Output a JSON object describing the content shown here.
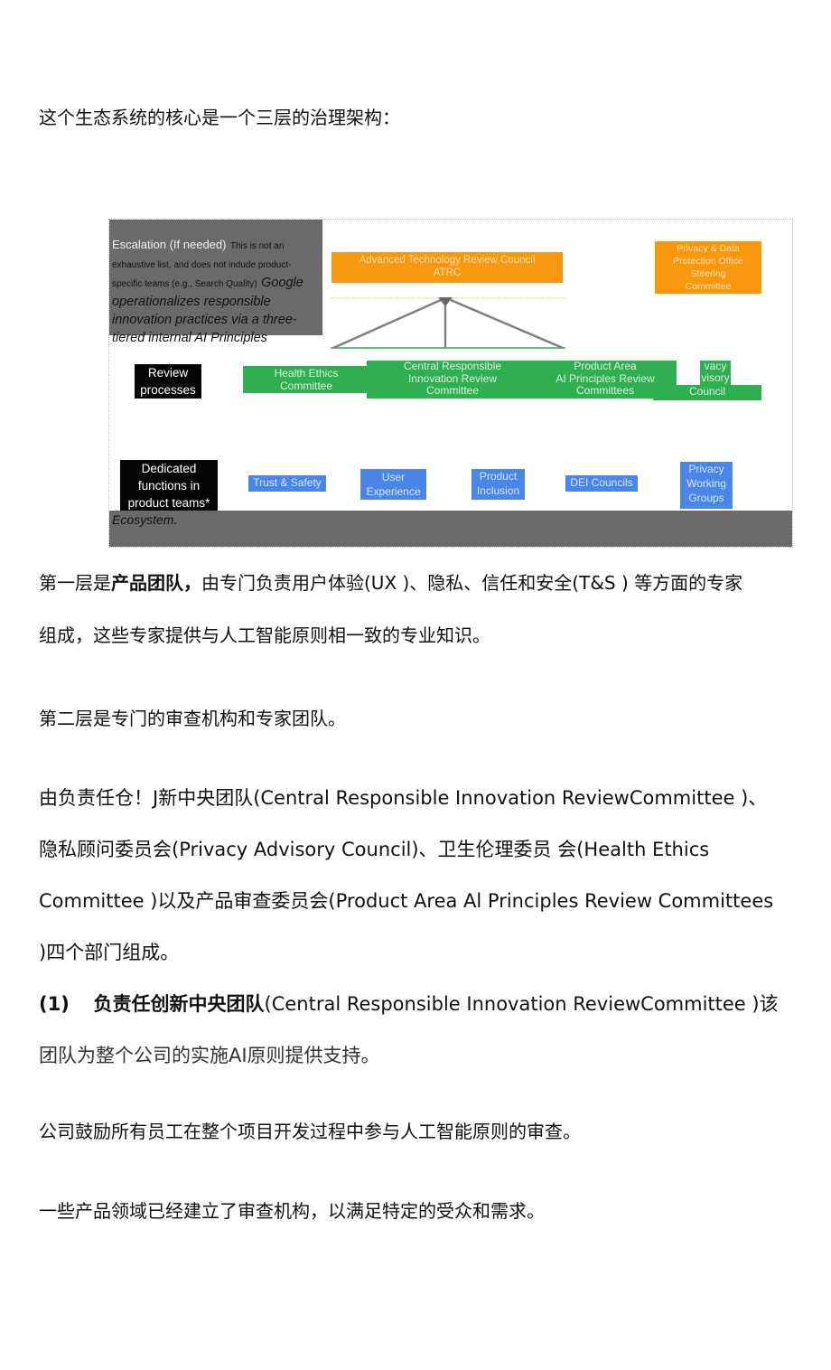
{
  "intro": "这个生态系统的核心是一个三层的治理架构：",
  "diagram": {
    "escalation": {
      "heading": "Escalation (If needed)",
      "note": "This is not an exhaustive list, and does not indude product-specific teams (e.g., Search Quality)",
      "caption": "Google operationalizes responsible innovation practices via a three-tiered internal AI Principles",
      "caption_end": "Ecosystem."
    },
    "tier3": {
      "atrc_line1": "Advanced Technology Review Council",
      "atrc_line2": "ATRC",
      "privacy_steering": [
        "Privacy & Data",
        "Protection Office",
        "Steering",
        "Committee"
      ]
    },
    "tier2": {
      "label": [
        "Review",
        "processes"
      ],
      "health_ethics": [
        "Health Ethics",
        "Committee"
      ],
      "central_ri": [
        "Central Responsible",
        "Innovation Review",
        "Committee"
      ],
      "product_area": [
        "Product Area",
        "AI Principles Review",
        "Committees"
      ],
      "privacy_advisory": [
        "vacy",
        "visory",
        "Council"
      ]
    },
    "tier1": {
      "label": [
        "Dedicated",
        "functions in",
        "product teams*"
      ],
      "trust_safety": "Trust & Safety",
      "user_experience": [
        "User",
        "Experience"
      ],
      "product_inclusion": [
        "Product",
        "Inclusion"
      ],
      "dei": "DEI Councils",
      "privacy_wg": [
        "Privacy",
        "Working",
        "Groups"
      ]
    },
    "colors": {
      "orange": "#f7980f",
      "green": "#2fae52",
      "blue": "#4a86e8",
      "gray": "#6a6a6a",
      "black": "#050505"
    }
  },
  "paragraphs": {
    "p1_bold_prefix": "第一层是",
    "p1_bold": "产品团队，",
    "p1_rest": "由专门负责用户体验(UX )、隐私、信任和安全(T&S ) 等方面的专家",
    "p1_line2": "组成，这些专家提供与人工智能原则相一致的专业知识。",
    "p2": "第二层是专门的审查机构和专家团队。",
    "p3_line1": "由负责任仓！J新中央团队(Central Responsible Innovation ReviewCommittee )、",
    "p3_line2": "隐私顾问委员会(Privacy Advisory Council)、卫生伦理委员  会(Health Ethics",
    "p3_line3": "Committee )以及产品审查委员会(Product Area Al Principles Review Committees",
    "p3_line4": ")四个部门组成。",
    "p4_num": "(1)",
    "p4_bold": "负责任创新中央团队",
    "p4_rest": "(Central Responsible Innovation ReviewCommittee )该",
    "p4_line2": "团队为整个公司的实施AI原则提供支持。",
    "p5": "公司鼓励所有员工在整个项目开发过程中参与人工智能原则的审查。",
    "p6": "一些产品领域已经建立了审查机构，以满足特定的受众和需求。"
  }
}
